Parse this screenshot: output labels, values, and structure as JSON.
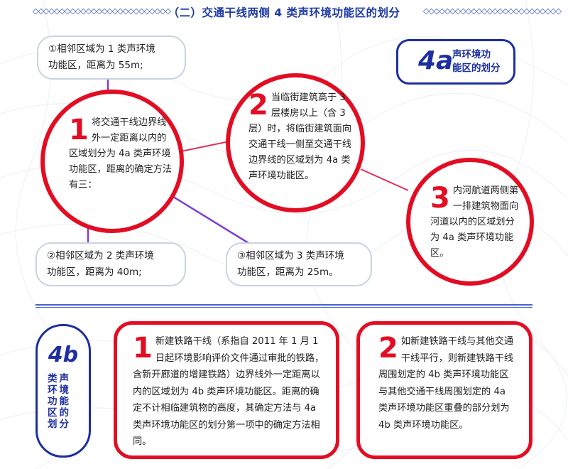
{
  "header": {
    "title": "（二）交通干线两侧 4 类声环境功能区的划分",
    "left_ornament": "◇◇◇◇◇◇◇◇◇◇◇◇◇◇◇◇◇◇◇◇◇◇◇◇◇◇",
    "right_ornament": "◇◇◇◇◇◇◇◇◇◇◇◇◇◇◇◇◇◇◇◇◇◇◇◇◇◇"
  },
  "section_4a": {
    "label_code": "4a",
    "label_text_line1": "声环境功",
    "label_text_line2": "能区的划分",
    "method_bubbles": [
      {
        "line1": "①相邻区域为 1 类声环境",
        "line2": "功能区，距离为 55m;"
      },
      {
        "line1": "②相邻区域为 2 类声环境",
        "line2": "功能区，距离为 40m;"
      },
      {
        "line1": "③相邻区域为 3 类声环境",
        "line2": "功能区，距离为 25m。"
      }
    ],
    "circles": [
      {
        "num": "1",
        "text": "将交通干线边界线外一定距离以内的区域划分为 4a 类声环境功能区，距离的确定方法有三："
      },
      {
        "num": "2",
        "text": "当临街建筑高于 3 层楼房以上（含 3 层）时，将临街建筑面向交通干线一侧至交通干线边界线的区域划为 4a 类声环境功能区。"
      },
      {
        "num": "3",
        "text": "内河航道两侧第一排建筑物面向河道以内的区域划分为 4a 类声环境功能区。"
      }
    ]
  },
  "section_4b": {
    "label_code": "4b",
    "label_chars": "类声环境功能区的划分",
    "boxes": [
      {
        "num": "1",
        "text": "新建铁路干线（系指自 2011 年 1 月 1 日起环境影响评价文件通过审批的铁路，含新开廊道的增建铁路）边界线外一定距离以内的区域划为 4b 类声环境功能区。距离的确定不计相临建筑物的高度，其确定方法与 4a 类声环境功能区的划分第一项中的确定方法相同。"
      },
      {
        "num": "2",
        "text": "如新建铁路干线与其他交通干线平行，则新建铁路干线周围划定的 4b 类声环境功能区与其他交通干线周围划定的 4a 类声环境功能区重叠的部分划为 4b 类声环境功能区。"
      }
    ]
  },
  "colors": {
    "accent_red": "#e30d23",
    "accent_blue": "#1d2fa0",
    "bubble_border": "#c8d3e2",
    "connector_purple": "#7b3fd0",
    "connector_pink": "#e0335a"
  }
}
